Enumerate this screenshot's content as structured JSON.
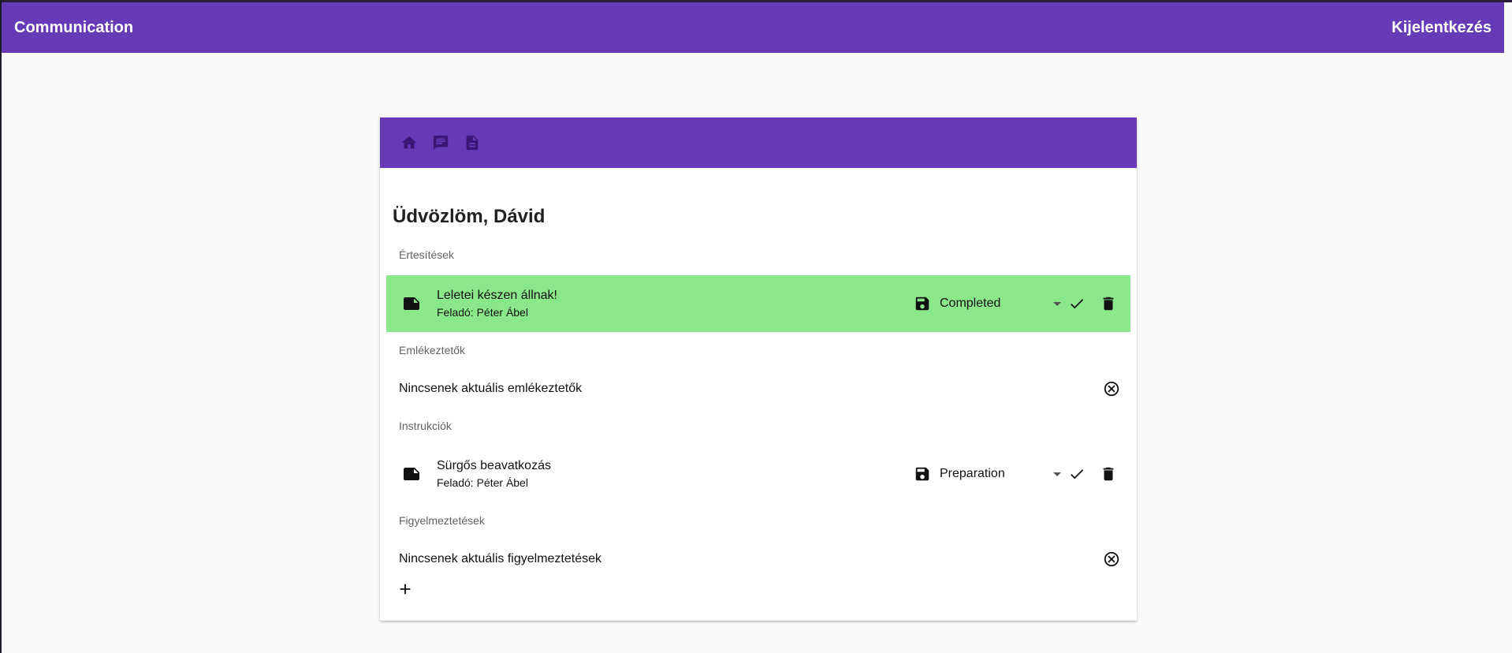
{
  "app": {
    "title": "Communication",
    "logout_label": "Kijelentkezés",
    "accent_color": "#673ab7"
  },
  "nav": {
    "icons": [
      "home-icon",
      "chat-icon",
      "description-icon"
    ]
  },
  "greeting": "Üdvözlöm, Dávid",
  "sections": {
    "notifications": {
      "label": "Értesítések",
      "items": [
        {
          "title": "Leletei készen állnak!",
          "sender": "Feladó: Péter Ábel",
          "status": "Completed",
          "highlight_color": "#8ae78a"
        }
      ]
    },
    "reminders": {
      "label": "Emlékeztetők",
      "empty_text": "Nincsenek aktuális emlékeztetők"
    },
    "instructions": {
      "label": "Instrukciók",
      "items": [
        {
          "title": "Sürgős beavatkozás",
          "sender": "Feladó: Péter Ábel",
          "status": "Preparation"
        }
      ]
    },
    "warnings": {
      "label": "Figyelmeztetések",
      "empty_text": "Nincsenek aktuális figyelmeztetések"
    }
  }
}
